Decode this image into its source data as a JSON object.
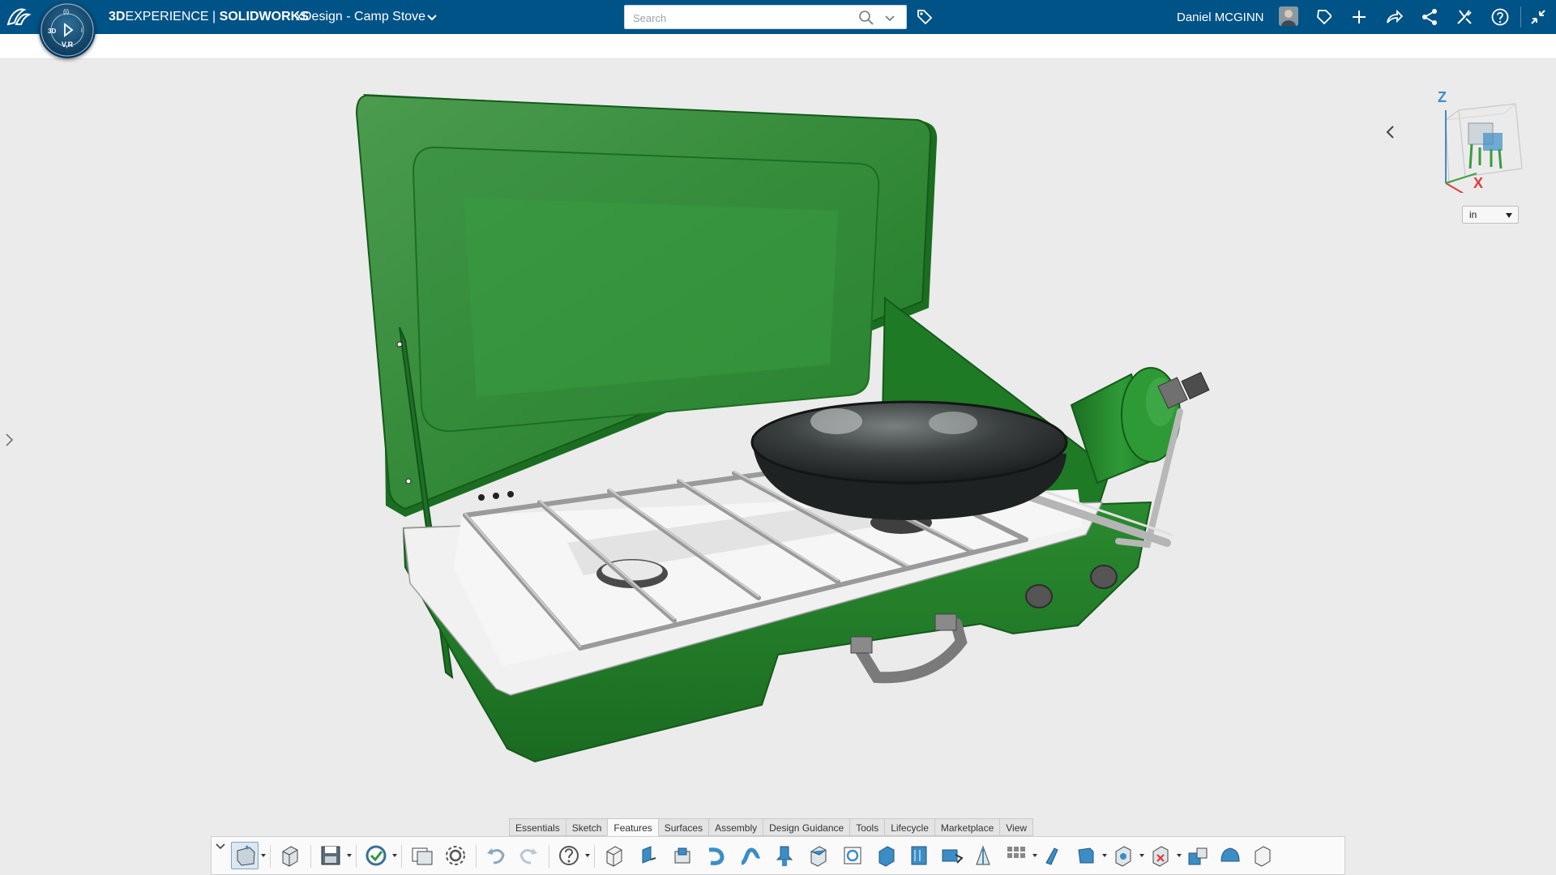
{
  "app": {
    "brand_bold": "3D",
    "brand_rest": "EXPERIENCE | ",
    "brand_product": "SOLIDWORKS",
    "app_name": "xDesign",
    "separator": " - ",
    "document_title": "Camp Stove",
    "compass_version": "V,R"
  },
  "search": {
    "placeholder": "Search",
    "value": ""
  },
  "user": {
    "name": "Daniel MCGINN"
  },
  "header_icons": [
    "tag-icon",
    "avatar",
    "share-community-icon",
    "add-icon",
    "share-icon",
    "network-share-icon",
    "tools-icon",
    "help-icon",
    "fullscreen-exit-icon"
  ],
  "viewport": {
    "units": "in",
    "view_cube_axes": [
      "Z",
      "X"
    ],
    "model_name": "Camp Stove",
    "colors": {
      "background": "#ebebeb",
      "body_green": "#1f7a26",
      "lid_green": "#2f8f35",
      "surface": "#f1f1f1",
      "pan": "#2a2e2e"
    }
  },
  "command_tabs": [
    {
      "label": "Essentials",
      "active": false
    },
    {
      "label": "Sketch",
      "active": false
    },
    {
      "label": "Features",
      "active": true
    },
    {
      "label": "Surfaces",
      "active": false
    },
    {
      "label": "Assembly",
      "active": false
    },
    {
      "label": "Design Guidance",
      "active": false
    },
    {
      "label": "Tools",
      "active": false
    },
    {
      "label": "Lifecycle",
      "active": false
    },
    {
      "label": "Marketplace",
      "active": false
    },
    {
      "label": "View",
      "active": false
    }
  ],
  "toolbar_tools": [
    "new-sketch-icon",
    "part-icon",
    "save-icon",
    "rebuild-icon",
    "manage-icon",
    "settings-icon",
    "undo-icon",
    "redo-icon",
    "help-icon",
    "extrude-icon",
    "sweep-icon",
    "revolve-icon",
    "fillet-icon",
    "chamfer-icon",
    "shell-icon",
    "draft-icon",
    "pattern-icon",
    "mirror-icon"
  ],
  "colors": {
    "topbar": "#005386",
    "accent": "#3c8dc6"
  }
}
